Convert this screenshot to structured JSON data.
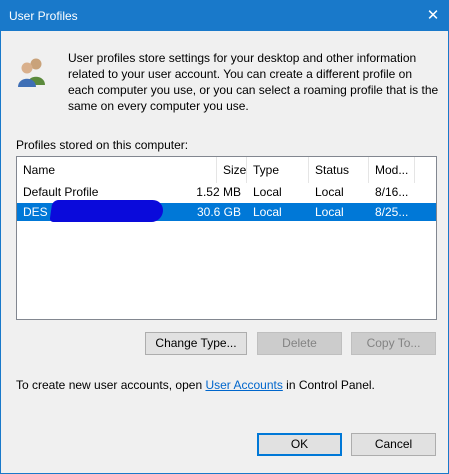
{
  "window": {
    "title": "User Profiles",
    "close_glyph": "✕"
  },
  "description": "User profiles store settings for your desktop and other information related to your user account. You can create a different profile on each computer you use, or you can select a roaming profile that is the same on every computer you use.",
  "profiles_label": "Profiles stored on this computer:",
  "table": {
    "columns": [
      "Name",
      "Size",
      "Type",
      "Status",
      "Mod..."
    ],
    "rows": [
      {
        "name": "Default Profile",
        "size": "1.52 MB",
        "type": "Local",
        "status": "Local",
        "modified": "8/16..."
      },
      {
        "name": "DES",
        "size": "30.6 GB",
        "type": "Local",
        "status": "Local",
        "modified": "8/25..."
      }
    ],
    "selected_row": 1
  },
  "buttons": {
    "change_type": "Change Type...",
    "delete": "Delete",
    "copy_to": "Copy To...",
    "ok": "OK",
    "cancel": "Cancel"
  },
  "footer": {
    "prefix": "To create new user accounts, open ",
    "link": "User Accounts",
    "suffix": " in Control Panel."
  },
  "colors": {
    "titlebar": "#1979ca",
    "selection": "#0078d7",
    "link": "#0066cc",
    "redaction": "#0a0adb"
  },
  "icons": {
    "users": "users-icon",
    "close": "close-icon"
  }
}
